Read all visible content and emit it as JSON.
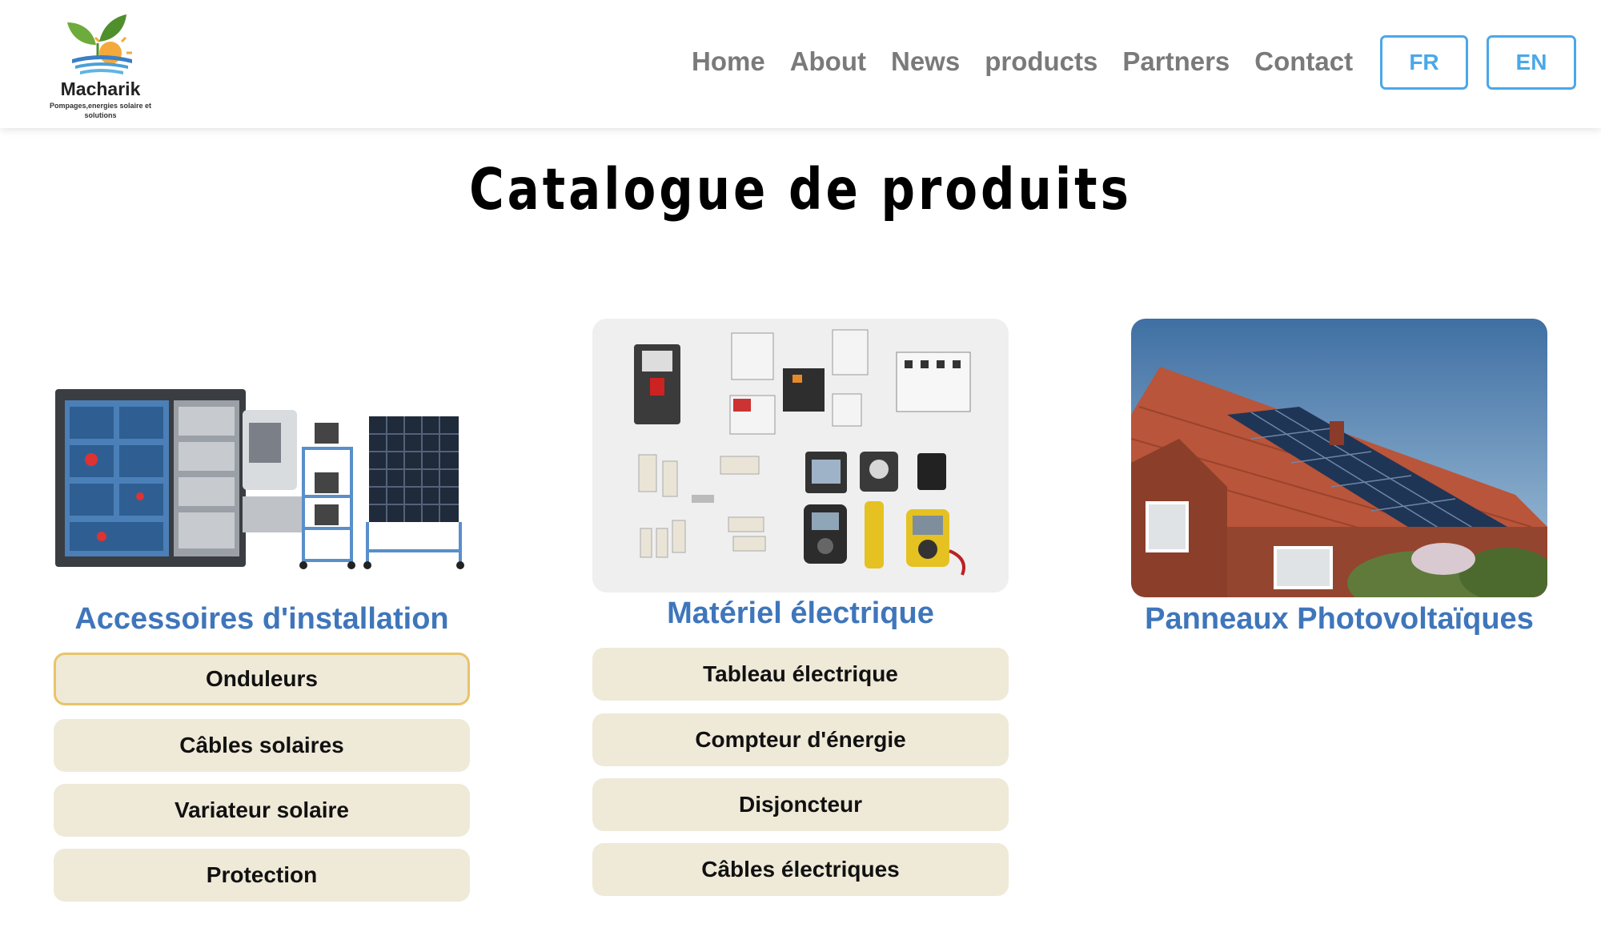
{
  "brand": {
    "name": "Macharik",
    "tagline": "Pompages,energies solaire et solutions"
  },
  "nav": {
    "items": [
      {
        "label": "Home"
      },
      {
        "label": "About"
      },
      {
        "label": "News"
      },
      {
        "label": "products"
      },
      {
        "label": "Partners"
      },
      {
        "label": "Contact"
      }
    ],
    "lang_fr": "FR",
    "lang_en": "EN"
  },
  "page": {
    "title": "Catalogue de produits"
  },
  "categories": [
    {
      "title": "Accessoires d'installation",
      "image_icon": "solar-training-equipment-image",
      "items": [
        {
          "label": "Onduleurs",
          "active": true
        },
        {
          "label": "Câbles solaires"
        },
        {
          "label": "Variateur solaire"
        },
        {
          "label": "Protection"
        }
      ]
    },
    {
      "title": "Matériel électrique",
      "image_icon": "electrical-components-image",
      "items": [
        {
          "label": "Tableau électrique"
        },
        {
          "label": "Compteur d'énergie"
        },
        {
          "label": "Disjoncteur"
        },
        {
          "label": "Câbles électriques"
        }
      ]
    },
    {
      "title": "Panneaux Photovoltaïques",
      "image_icon": "house-solar-roof-image",
      "items": []
    }
  ],
  "colors": {
    "accent": "#4aa8e8",
    "category_title": "#3f76bb",
    "item_bg": "#efe9d8",
    "active_border": "#e8c46a",
    "nav_text": "#7a7a7a"
  }
}
